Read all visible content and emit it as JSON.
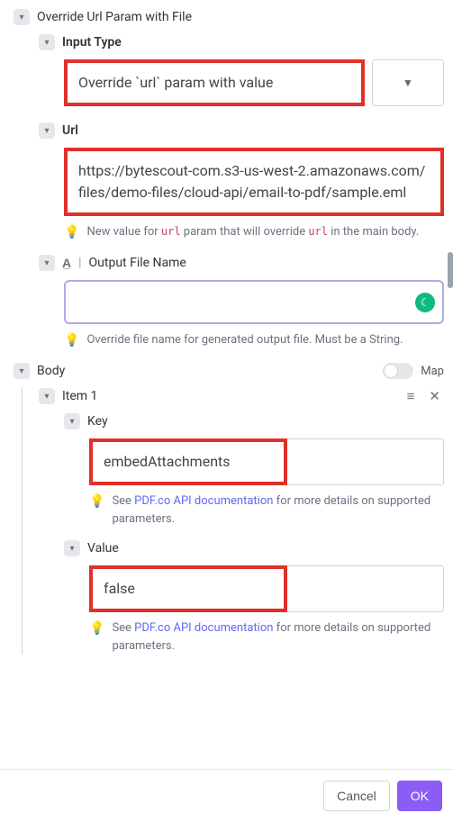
{
  "section": {
    "override_url_param_label": "Override Url Param with File",
    "input_type_label": "Input Type",
    "input_type_value": "Override `url` param with value",
    "url_label": "Url",
    "url_value": "https://bytescout-com.s3-us-west-2.amazonaws.com/files/demo-files/cloud-api/email-to-pdf/sample.eml",
    "url_hint_prefix": "New value for ",
    "url_hint_code1": "url",
    "url_hint_mid": " param that will override ",
    "url_hint_code2": "url",
    "url_hint_suffix": " in the main body.",
    "output_file_label": "Output File Name",
    "output_file_value": "",
    "output_file_hint": "Override file name for generated output file. Must be a String."
  },
  "body": {
    "label": "Body",
    "map_label": "Map",
    "map_on": false,
    "item1": {
      "label": "Item 1",
      "key_label": "Key",
      "key_value": "embedAttachments",
      "key_hint_prefix": "See ",
      "key_hint_link": "PDF.co API documentation",
      "key_hint_suffix": " for more details on supported parameters.",
      "value_label": "Value",
      "value_value": "false",
      "value_hint_prefix": "See ",
      "value_hint_link": "PDF.co API documentation",
      "value_hint_suffix": " for more details on supported parameters."
    }
  },
  "footer": {
    "cancel": "Cancel",
    "ok": "OK"
  }
}
